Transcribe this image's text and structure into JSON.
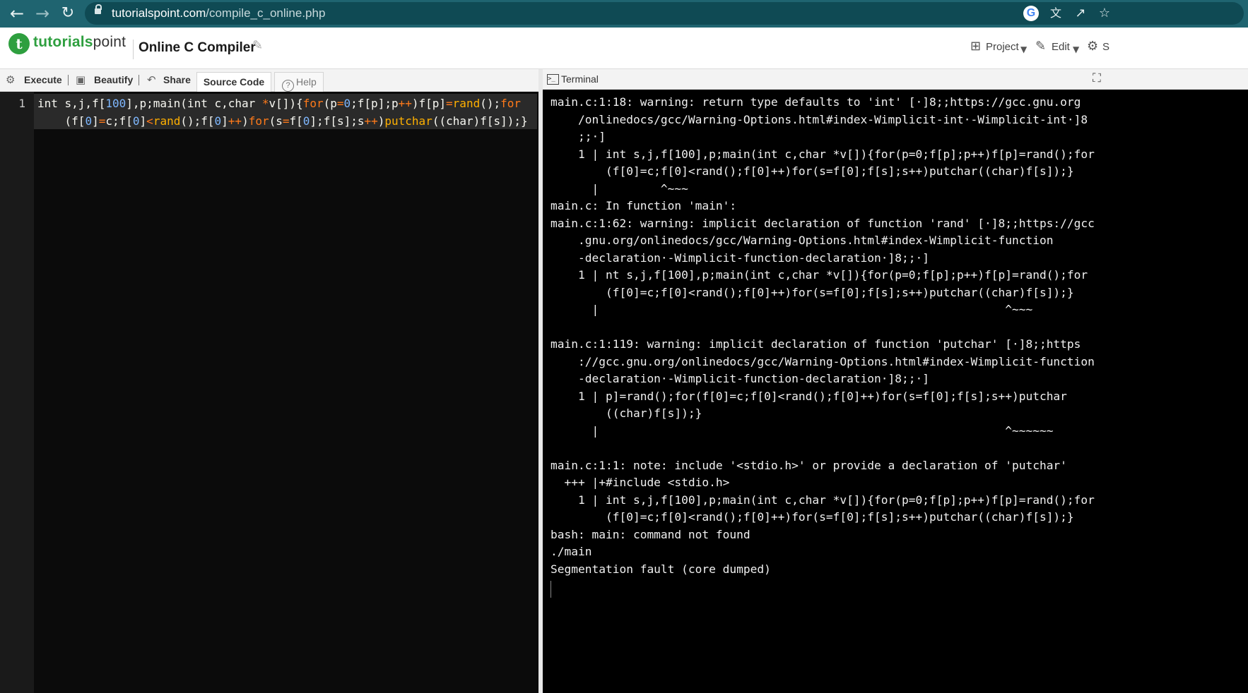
{
  "browser": {
    "url_host": "tutorialspoint.com",
    "url_path": "/compile_c_online.php",
    "icons": [
      "back-icon",
      "forward-icon",
      "reload-icon",
      "lock-icon",
      "google-icon",
      "translate-icon",
      "share-icon",
      "star-icon"
    ]
  },
  "header": {
    "logo_mark": "t",
    "logo_text_a": "tutorials",
    "logo_text_b": "point",
    "title": "Online C Compiler",
    "project_label": "Project",
    "edit_label": "Edit",
    "settings_label": "S"
  },
  "toolbar": {
    "execute_label": "Execute",
    "beautify_label": "Beautify",
    "share_label": "Share",
    "source_code_tab": "Source Code",
    "help_tab": "Help"
  },
  "editor": {
    "line_number": "1",
    "line_1a": "int s,j,f[100],p;main(int c,char *v[]){for(p=0;f[p];p++)f[p]=rand();for",
    "line_1b": "    (f[0]=c;f[0]<rand();f[0]++)for(s=f[0];f[s];s++)putchar((char)f[s]);}"
  },
  "terminal": {
    "label": "Terminal",
    "lines": [
      "main.c:1:18: warning: return type defaults to 'int' [·]8;;https://gcc.gnu.org",
      "    /onlinedocs/gcc/Warning-Options.html#index-Wimplicit-int·-Wimplicit-int·]8",
      "    ;;·]",
      "    1 | int s,j,f[100],p;main(int c,char *v[]){for(p=0;f[p];p++)f[p]=rand();for",
      "        (f[0]=c;f[0]<rand();f[0]++)for(s=f[0];f[s];s++)putchar((char)f[s]);}",
      "      |         ^~~~",
      "main.c: In function 'main':",
      "main.c:1:62: warning: implicit declaration of function 'rand' [·]8;;https://gcc",
      "    .gnu.org/onlinedocs/gcc/Warning-Options.html#index-Wimplicit-function",
      "    -declaration·-Wimplicit-function-declaration·]8;;·]",
      "    1 | nt s,j,f[100],p;main(int c,char *v[]){for(p=0;f[p];p++)f[p]=rand();for",
      "        (f[0]=c;f[0]<rand();f[0]++)for(s=f[0];f[s];s++)putchar((char)f[s]);}",
      "      |                                                           ^~~~",
      "",
      "main.c:1:119: warning: implicit declaration of function 'putchar' [·]8;;https",
      "    ://gcc.gnu.org/onlinedocs/gcc/Warning-Options.html#index-Wimplicit-function",
      "    -declaration·-Wimplicit-function-declaration·]8;;·]",
      "    1 | p]=rand();for(f[0]=c;f[0]<rand();f[0]++)for(s=f[0];f[s];s++)putchar",
      "        ((char)f[s]);}",
      "      |                                                           ^~~~~~~",
      "",
      "main.c:1:1: note: include '<stdio.h>' or provide a declaration of 'putchar'",
      "  +++ |+#include <stdio.h>",
      "    1 | int s,j,f[100],p;main(int c,char *v[]){for(p=0;f[p];p++)f[p]=rand();for",
      "        (f[0]=c;f[0]<rand();f[0]++)for(s=f[0];f[s];s++)putchar((char)f[s]);}",
      "bash: main: command not found",
      "./main",
      "Segmentation fault (core dumped)"
    ]
  },
  "colors": {
    "browser_bar": "#1f6470",
    "brand_green": "#2e9f3f",
    "editor_bg": "#0b0b0b",
    "keyword": "#ff7a1a",
    "function": "#ffb000",
    "number": "#7fb8ff"
  }
}
